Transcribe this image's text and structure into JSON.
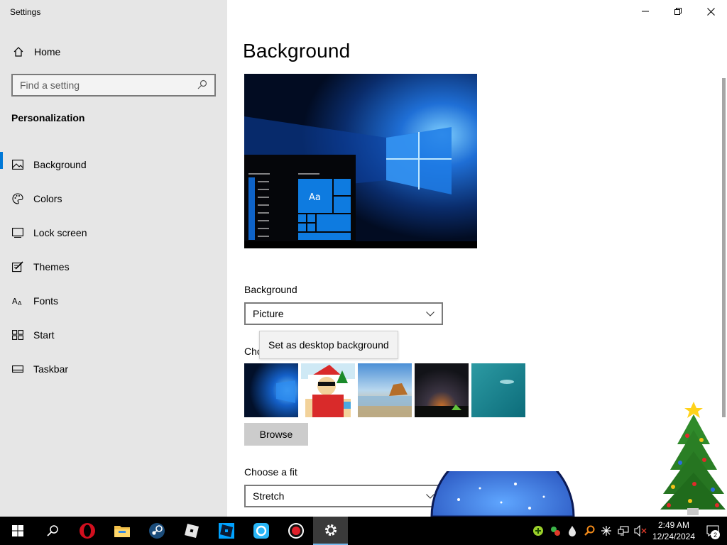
{
  "window": {
    "title": "Settings"
  },
  "sidebar": {
    "home_label": "Home",
    "search_placeholder": "Find a setting",
    "section_title": "Personalization",
    "items": [
      {
        "label": "Background",
        "icon": "picture-icon",
        "active": true
      },
      {
        "label": "Colors",
        "icon": "palette-icon"
      },
      {
        "label": "Lock screen",
        "icon": "lock-screen-icon"
      },
      {
        "label": "Themes",
        "icon": "themes-icon"
      },
      {
        "label": "Fonts",
        "icon": "fonts-icon"
      },
      {
        "label": "Start",
        "icon": "start-icon"
      },
      {
        "label": "Taskbar",
        "icon": "taskbar-icon"
      }
    ]
  },
  "main": {
    "title": "Background",
    "preview_tile_text": "Aa",
    "background_label": "Background",
    "background_value": "Picture",
    "choose_picture_label": "Cho",
    "tooltip": "Set as desktop background",
    "browse_label": "Browse",
    "fit_label": "Choose a fit",
    "fit_value": "Stretch"
  },
  "taskbar": {
    "apps": [
      "windows-start-icon",
      "search-icon",
      "opera-icon",
      "file-explorer-icon",
      "steam-icon",
      "roblox-icon",
      "roblox-studio-icon",
      "sync-app-icon",
      "record-icon",
      "settings-gear-icon"
    ],
    "clock_time": "2:49 AM",
    "clock_date": "12/24/2024",
    "notification_count": "2"
  },
  "colors": {
    "accent": "#0078d7",
    "sidebar_bg": "#e6e6e6",
    "taskbar_bg": "#000000"
  }
}
